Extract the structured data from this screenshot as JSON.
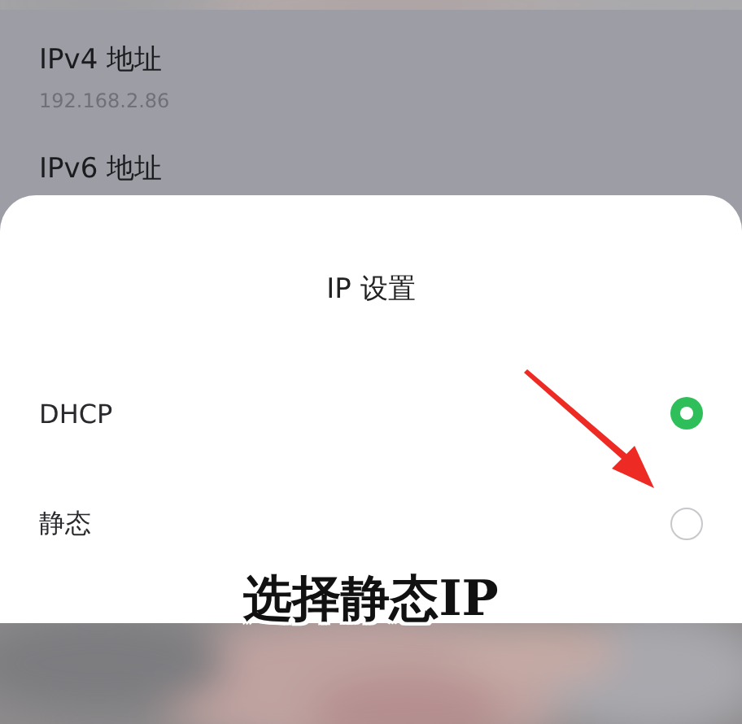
{
  "settings_list": [
    {
      "title": "IPv4 地址",
      "value": "192.168.2.86"
    },
    {
      "title": "IPv6 地址"
    }
  ],
  "dialog": {
    "title": "IP 设置",
    "options": [
      {
        "label": "DHCP",
        "selected": true
      },
      {
        "label": "静态",
        "selected": false
      }
    ]
  },
  "caption": "选择静态IP"
}
